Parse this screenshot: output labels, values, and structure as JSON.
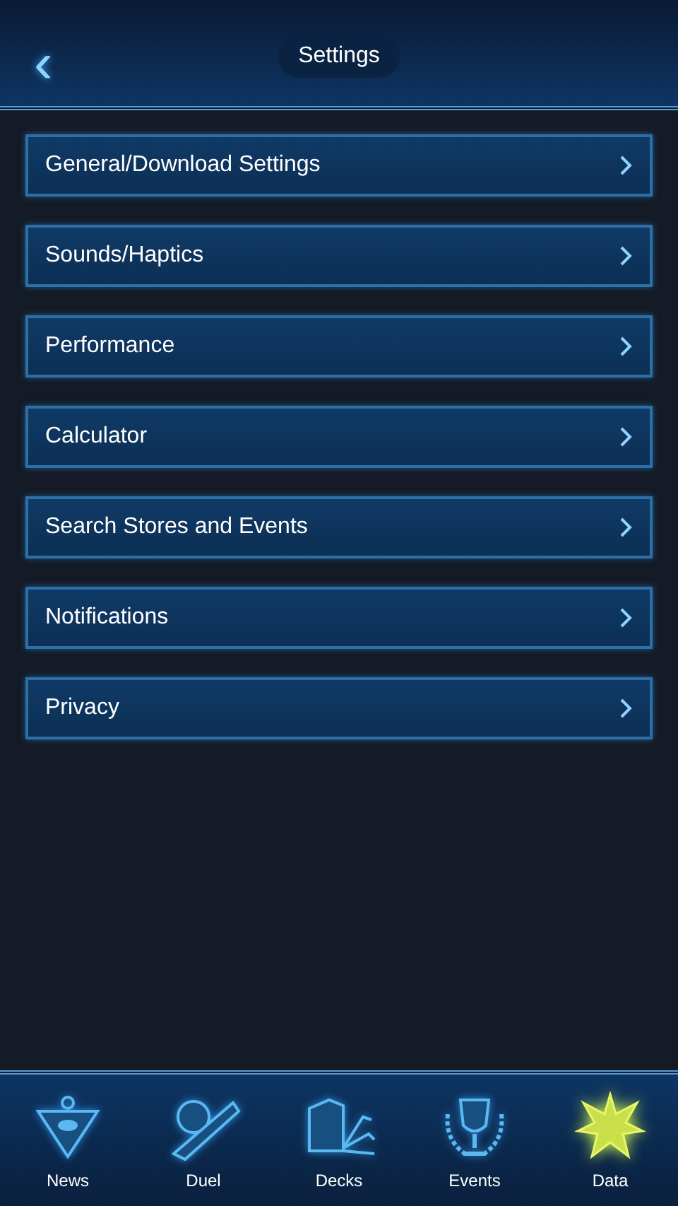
{
  "header": {
    "back": "‹",
    "title": "Settings"
  },
  "menu": [
    {
      "label": "General/Download Settings"
    },
    {
      "label": "Sounds/Haptics"
    },
    {
      "label": "Performance"
    },
    {
      "label": "Calculator"
    },
    {
      "label": "Search Stores and Events"
    },
    {
      "label": "Notifications"
    },
    {
      "label": "Privacy"
    }
  ],
  "tabs": [
    {
      "label": "News",
      "kind": "pyramid",
      "selected": false
    },
    {
      "label": "Duel",
      "kind": "disk",
      "selected": false
    },
    {
      "label": "Decks",
      "kind": "deck",
      "selected": false
    },
    {
      "label": "Events",
      "kind": "trophy",
      "selected": false
    },
    {
      "label": "Data",
      "kind": "star",
      "selected": true
    }
  ]
}
